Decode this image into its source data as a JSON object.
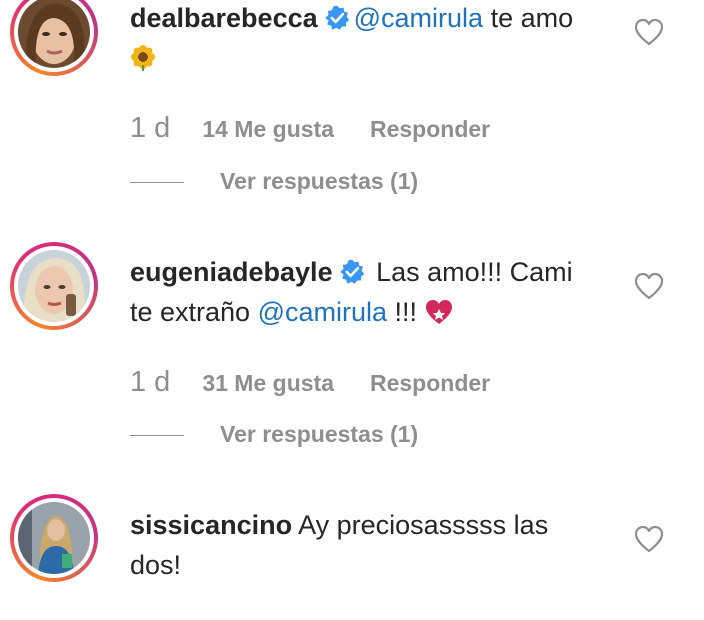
{
  "comments": [
    {
      "username": "dealbarebecca",
      "verified": true,
      "mention": "@camirula",
      "text_after": " te amo ",
      "emoji": "sunflower",
      "age": "1 d",
      "likes": "14 Me gusta",
      "reply_label": "Responder",
      "view_replies": "Ver respuestas (1)"
    },
    {
      "username": "eugeniadebayle",
      "verified": true,
      "text_before": " Las amo!!! Cami te extraño ",
      "mention": "@camirula",
      "text_after": " !!! ",
      "emoji": "heart-decoration",
      "age": "1 d",
      "likes": "31 Me gusta",
      "reply_label": "Responder",
      "view_replies": "Ver respuestas (1)"
    },
    {
      "username": "sissicancino",
      "verified": false,
      "text_after": " Ay preciosasssss las dos!"
    }
  ],
  "colors": {
    "verified": "#3897f0",
    "mention": "#1e73be",
    "muted": "#8e8e8e",
    "text": "#262626"
  }
}
